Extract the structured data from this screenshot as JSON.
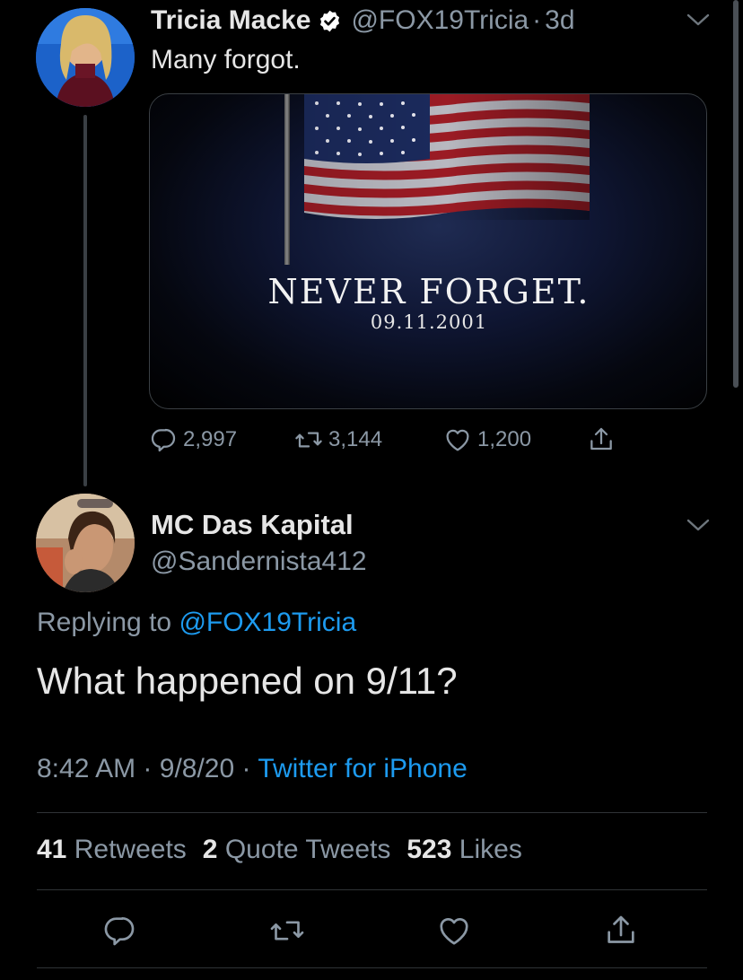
{
  "parent_tweet": {
    "author_name": "Tricia Macke",
    "handle": "@FOX19Tricia",
    "separator": "·",
    "time": "3d",
    "text": "Many forgot.",
    "media": {
      "headline": "NEVER FORGET.",
      "date": "09.11.2001"
    },
    "replies": "2,997",
    "retweets": "3,144",
    "likes": "1,200"
  },
  "reply_tweet": {
    "author_name": "MC Das Kapital",
    "handle": "@Sandernista412",
    "replying_prefix": "Replying to",
    "replying_handle": "@FOX19Tricia",
    "text": "What happened on 9/11?",
    "time": "8:42 AM",
    "date": "9/8/20",
    "source": "Twitter for iPhone",
    "separator": "·"
  },
  "stats": {
    "retweets_count": "41",
    "retweets_label": "Retweets",
    "quotes_count": "2",
    "quotes_label": "Quote Tweets",
    "likes_count": "523",
    "likes_label": "Likes"
  },
  "colors": {
    "background": "#000000",
    "link": "#1d9bf0",
    "secondary_text": "#8b98a5",
    "verified_badge": "#ffffff"
  },
  "icons": [
    "verified-badge-icon",
    "chevron-down-icon",
    "reply-icon",
    "retweet-icon",
    "like-icon",
    "share-icon"
  ]
}
